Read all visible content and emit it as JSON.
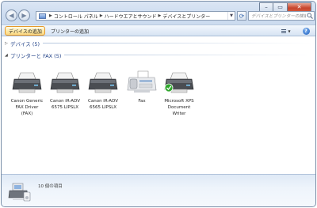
{
  "window": {
    "min_icon": "minimize-icon",
    "max_icon": "maximize-icon",
    "close_icon": "close-icon"
  },
  "nav": {
    "breadcrumbs": [
      "コントロール パネル",
      "ハードウエアとサウンド",
      "デバイスとプリンター"
    ],
    "search_placeholder": "デバイスとプリンターの検索"
  },
  "toolbar": {
    "add_device": "デバイスの追加",
    "add_printer": "プリンターの追加"
  },
  "groups": {
    "devices": "デバイス (5)",
    "printers": "プリンターと FAX (5)"
  },
  "printers": [
    {
      "label": "Canon Generic FAX Driver (FAX)",
      "icon": "printer-icon",
      "default": false
    },
    {
      "label": "Canon iR-ADV 6575 LIPSLX",
      "icon": "printer-icon",
      "default": false
    },
    {
      "label": "Canon iR-ADV 6565 LIPSLX",
      "icon": "printer-icon",
      "default": false
    },
    {
      "label": "Fax",
      "icon": "fax-icon",
      "default": false
    },
    {
      "label": "Microsoft XPS Document Writer",
      "icon": "printer-icon",
      "default": true
    }
  ],
  "details": {
    "count_text": "10 個の項目"
  },
  "colors": {
    "accent": "#1e3f86",
    "selected_button": "#fbd882",
    "default_check": "#2fa62c"
  }
}
